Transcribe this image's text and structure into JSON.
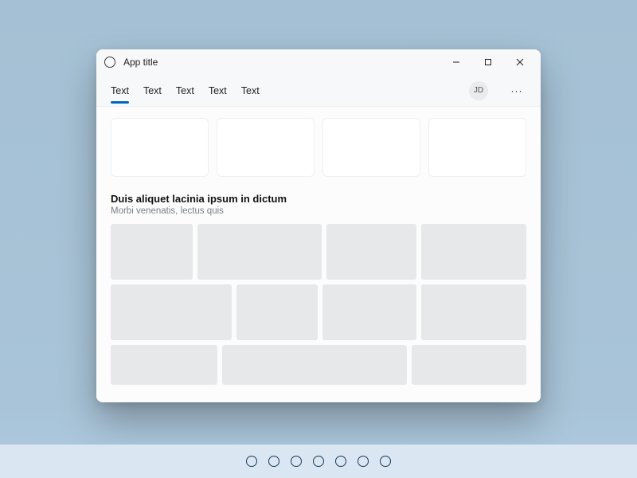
{
  "window": {
    "title": "App title"
  },
  "tabs": [
    "Text",
    "Text",
    "Text",
    "Text",
    "Text"
  ],
  "activeTab": 0,
  "avatar": "JD",
  "section": {
    "title": "Duis aliquet lacinia ipsum in dictum",
    "subtitle": "Morbi venenatis, lectus quis"
  },
  "taskbar": {
    "icons": 7
  }
}
